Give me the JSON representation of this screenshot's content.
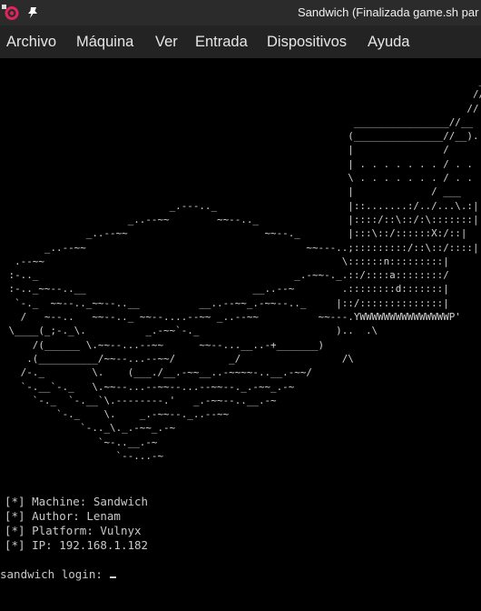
{
  "window": {
    "title": "Sandwich (Finalizada game.sh par"
  },
  "icons": {
    "app": "virtualbox-app-icon",
    "pin": "pin-icon"
  },
  "menu": {
    "items": [
      {
        "label": "Archivo"
      },
      {
        "label": "Máquina"
      },
      {
        "label": "Ver"
      },
      {
        "label": "Entrada"
      },
      {
        "label": "Dispositivos"
      },
      {
        "label": "Ayuda"
      }
    ]
  },
  "console": {
    "ascii_art": "                                                                                _\n                                                                               //\n                                                                              //\n                                                           ________________//__\n                                                          (_______________//__).\n                                                          |               /      |\n                                                          | . . . . . . . / . . . |\n                                                          \\ . . . . . . . / . . . /\n                                                          |             / ___     |\n                            _.---.._                      |::.......:/../...\\.:|\n                     _..--~~        ~~--.._               |::::/::\\::/:\\:::::::|\n              _..--~~                       ~~--._        |:::\\::/::::::X:/::|\n       _..--~~                                     ~~---..;:::::::::/::\\::/::::|\n  .--~~                                                  \\::::::n:::::::::|\n :-.._                                           _.-~~-._.::/::::a::::::::/\n :-.._~~--..__                            __..--~        .::::::::d:::::::|\n  `-._  ~~--.._~~--..__          __..--~~_.-~~--.._     |::/::::::::::::::|\n   /   ~--..   ~~--.._ ~~--....--~~ _..--~~          ~~---.YWWWWWWWWWWWWWWWP'\n \\____(_;-._\\.          _.-~~`-._                       )..  .\\\n     /(______ \\.~~--...--~~      ~~--...__..-+_______)\n    .(__________/~~--...--~~/         _/                 /\\\n   /-._        \\.    (___./__.-~~__..-~~~~-..__.-~~/\n   `-.__`-._   \\.~~--...--~~--...--~~--._.-~~_.-~\n     `-._  `-.__`\\.--------.'   _.-~~--..__.-~\n         `-._    \\.    _.-~~--._..--~~\n             `-.._\\._.-~~_.-~\n                `~-..__.-~\n                   `--...-~\n",
    "info": [
      {
        "prefix": "[*]",
        "text": "Machine: Sandwich"
      },
      {
        "prefix": "[*]",
        "text": "Author: Lenam"
      },
      {
        "prefix": "[*]",
        "text": "Platform: Vulnyx"
      },
      {
        "prefix": "[*]",
        "text": "IP: 192.168.1.182"
      }
    ],
    "login_prompt": "sandwich login: "
  },
  "colors": {
    "background": "#000000",
    "text": "#c9c9c9",
    "titlebar": "#2b2b2b",
    "menubar": "#232323"
  }
}
